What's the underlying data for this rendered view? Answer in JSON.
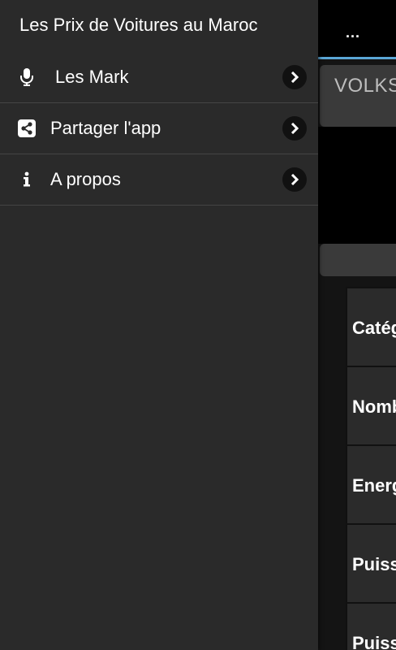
{
  "drawer": {
    "title": "Les Prix de Voitures au Maroc",
    "items": [
      {
        "label": "Les Mark",
        "icon": "microphone-icon"
      },
      {
        "label": "Partager l'app",
        "icon": "share-icon"
      },
      {
        "label": "A propos",
        "icon": "info-icon"
      }
    ]
  },
  "background": {
    "overflow_menu": "...",
    "brand": "VOLKS",
    "rows": [
      "Catég",
      "Nomb",
      "Energ",
      "Puiss",
      "Puiss"
    ]
  },
  "colors": {
    "drawer_bg": "#2a2a2a",
    "accent_line": "#5aa6d6"
  }
}
